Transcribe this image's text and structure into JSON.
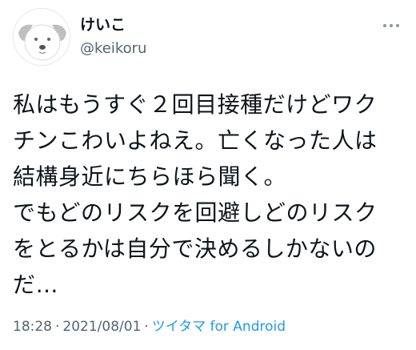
{
  "author": {
    "display_name": "けいこ",
    "handle": "@keikoru",
    "avatar_icon": "dog-avatar-icon"
  },
  "tweet": {
    "lines": [
      "私はもうすぐ２回目接種だけどワク",
      "チンこわいよねえ。亡くなった人は",
      "結構身近にちらほら聞く。",
      "でもどのリスクを回避しどのリスク",
      "をとるかは自分で決めるしかないの",
      "だ…"
    ]
  },
  "meta": {
    "time": "18:28",
    "separator": "·",
    "date": "2021/08/01",
    "source": "ツイタマ for Android"
  },
  "menu": {
    "icon": "more-options-icon"
  },
  "colors": {
    "text": "#0f1419",
    "secondary": "#536471",
    "link": "#1d9bf0"
  }
}
